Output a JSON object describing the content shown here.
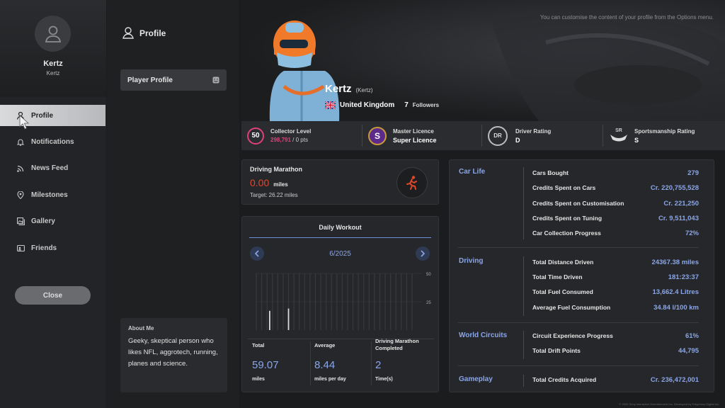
{
  "user": {
    "name": "Kertz",
    "subname": "Kertz",
    "handle": "(Kertz)",
    "country": "United Kingdom",
    "followers_count": "7",
    "followers_label": "Followers"
  },
  "banner_notice": "You can customise the content of your profile from the Options menu.",
  "nav": [
    {
      "label": "Profile",
      "icon": "person-icon",
      "active": true
    },
    {
      "label": "Notifications",
      "icon": "bell-icon"
    },
    {
      "label": "News Feed",
      "icon": "rss-icon"
    },
    {
      "label": "Milestones",
      "icon": "location-pin-icon"
    },
    {
      "label": "Gallery",
      "icon": "gallery-icon"
    },
    {
      "label": "Friends",
      "icon": "friends-icon"
    }
  ],
  "close_label": "Close",
  "middle": {
    "title": "Profile",
    "player_profile_label": "Player Profile",
    "about_title": "About Me",
    "about_text": "Geeky, skeptical person who likes NFL, aggrotech, running, planes and science."
  },
  "stats": {
    "collector": {
      "level": "50",
      "title": "Collector Level",
      "points": "298,791",
      "pts_suffix": "/ 0 pts"
    },
    "licence": {
      "badge": "S",
      "title": "Master Licence",
      "value": "Super Licence"
    },
    "driver_rating": {
      "badge": "DR",
      "title": "Driver Rating",
      "value": "D"
    },
    "sportsmanship": {
      "badge": "SR",
      "title": "Sportsmanship Rating",
      "value": "S"
    }
  },
  "marathon": {
    "title": "Driving Marathon",
    "value": "0.00",
    "unit": "miles",
    "target": "Target: 26.22 miles"
  },
  "workout": {
    "title": "Daily Workout",
    "month": "6/2025",
    "total_label": "Total",
    "total_value": "59.07",
    "total_unit": "miles",
    "avg_label": "Average",
    "avg_value": "8.44",
    "avg_unit": "miles per day",
    "completed_label": "Driving Marathon Completed",
    "completed_value": "2",
    "completed_unit": "Time(s)"
  },
  "chart_data": {
    "type": "bar",
    "ylim": [
      0,
      50
    ],
    "yticks": [
      "50",
      "25"
    ],
    "days": 30,
    "values": [
      0,
      0,
      0,
      0,
      0,
      0,
      19,
      0,
      0,
      0,
      0,
      0,
      0,
      0,
      0,
      0,
      0,
      0,
      0,
      0,
      0,
      0,
      0,
      0,
      0,
      0,
      0,
      0,
      0,
      0
    ],
    "values_note_day": "day 7 ≈ 19 miles"
  },
  "right": {
    "sections": [
      {
        "title": "Car Life",
        "rows": [
          {
            "label": "Cars Bought",
            "value": "279"
          },
          {
            "label": "Credits Spent on Cars",
            "value": "Cr.  220,755,528"
          },
          {
            "label": "Credits Spent on Customisation",
            "value": "Cr.  221,250"
          },
          {
            "label": "Credits Spent on Tuning",
            "value": "Cr.  9,511,043"
          },
          {
            "label": "Car Collection Progress",
            "value": "72%"
          }
        ]
      },
      {
        "title": "Driving",
        "rows": [
          {
            "label": "Total Distance Driven",
            "value": "24367.38 miles"
          },
          {
            "label": "Total Time Driven",
            "value": "181:23:37"
          },
          {
            "label": "Total Fuel Consumed",
            "value": "13,662.4 Litres"
          },
          {
            "label": "Average Fuel Consumption",
            "value": "34.84 l/100 km"
          }
        ]
      },
      {
        "title": "World Circuits",
        "rows": [
          {
            "label": "Circuit Experience Progress",
            "value": "61%"
          },
          {
            "label": "Total Drift Points",
            "value": "44,795"
          }
        ]
      },
      {
        "title": "Gameplay",
        "rows": [
          {
            "label": "Total Credits Acquired",
            "value": "Cr.  236,472,001"
          }
        ]
      }
    ]
  },
  "footer": "© 2025 Sony Interactive Entertainment Inc. Developed by Polyphony Digital Inc.",
  "colors": {
    "accent": "#8aa6e8",
    "marathon_red": "#e0482c",
    "collector_pink": "#e0407a",
    "licence_purple": "#7a3fb0"
  }
}
